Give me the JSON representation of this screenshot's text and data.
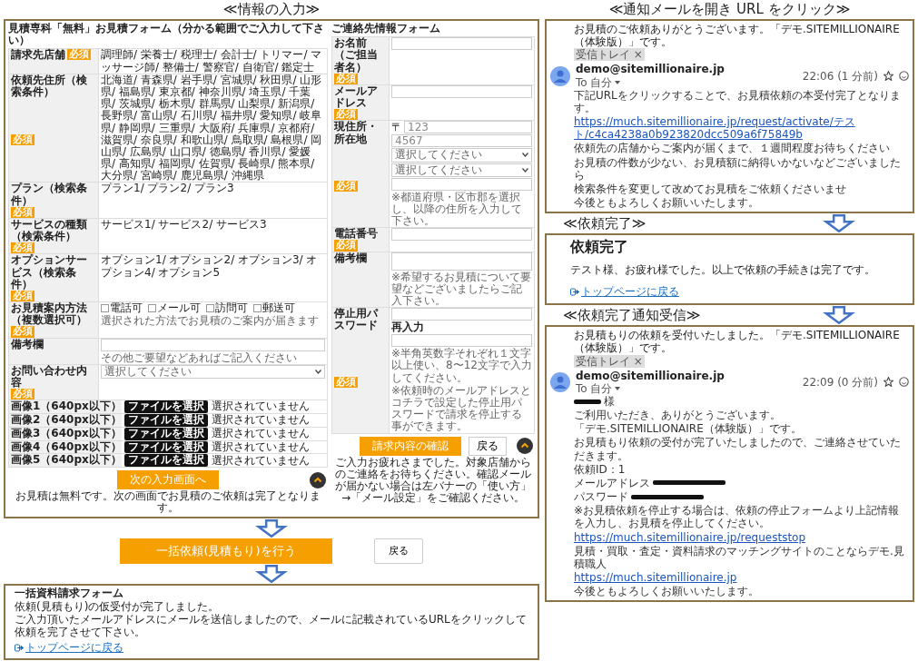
{
  "input_step": {
    "heading": "≪情報の入力≫",
    "estimate_form": {
      "title": "見積専科「無料」お見積フォーム（分かる範囲でご入力して下さい）",
      "rows": [
        {
          "kind": "text",
          "label": "請求先店舗",
          "badge": "必須",
          "value": "調理師/ 栄養士/ 税理士/ 会計士/ トリマー/ マッサージ師/ 整備士/ 警察官/ 自衛官/ 鑑定士"
        },
        {
          "kind": "text",
          "label": "依頼先住所（検索条件）",
          "badge": "必須",
          "value": "北海道/ 青森県/ 岩手県/ 宮城県/ 秋田県/ 山形県/ 福島県/ 東京都/ 神奈川県/ 埼玉県/ 千葉県/ 茨城県/ 栃木県/ 群馬県/ 山梨県/ 新潟県/ 長野県/ 富山県/ 石川県/ 福井県/ 愛知県/ 岐阜県/ 静岡県/ 三重県/ 大阪府/ 兵庫県/ 京都府/ 滋賀県/ 奈良県/ 和歌山県/ 鳥取県/ 島根県/ 岡山県/ 広島県/ 山口県/ 徳島県/ 香川県/ 愛媛県/ 高知県/ 福岡県/ 佐賀県/ 長崎県/ 熊本県/ 大分県/ 宮崎県/ 鹿児島県/ 沖縄県"
        },
        {
          "kind": "text",
          "label": "プラン（検索条件）",
          "badge": "必須",
          "value": "プラン1/ プラン2/ プラン3"
        },
        {
          "kind": "text",
          "label": "サービスの種類（検索条件）",
          "badge": "必須",
          "value": "サービス1/ サービス2/ サービス3"
        },
        {
          "kind": "text",
          "label": "オプションサービス（検索条件）",
          "badge": "必須",
          "value": "オプション1/ オプション2/ オプション3/ オプション4/ オプション5"
        },
        {
          "kind": "checkboxes",
          "label": "お見積案内方法（複数選択可）",
          "badge": "必須",
          "options": [
            {
              "label": "電話可",
              "checked": false
            },
            {
              "label": "メール可",
              "checked": false
            },
            {
              "label": "訪問可",
              "checked": false
            },
            {
              "label": "郵送可",
              "checked": false
            }
          ],
          "note": "選択された方法でお見積のご案内が届きます"
        },
        {
          "kind": "input",
          "label": "備考欄",
          "note": "その他ご要望などあればご記入ください"
        },
        {
          "kind": "select",
          "label": "お問い合わせ内容",
          "badge": "必須",
          "placeholder": "選択してください"
        },
        {
          "kind": "file",
          "label": "画像1（640px以下）",
          "button": "ファイルを選択",
          "status": "選択されていません"
        },
        {
          "kind": "file",
          "label": "画像2（640px以下）",
          "button": "ファイルを選択",
          "status": "選択されていません"
        },
        {
          "kind": "file",
          "label": "画像3（640px以下）",
          "button": "ファイルを選択",
          "status": "選択されていません"
        },
        {
          "kind": "file",
          "label": "画像4（640px以下）",
          "button": "ファイルを選択",
          "status": "選択されていません"
        },
        {
          "kind": "file",
          "label": "画像5（640px以下）",
          "button": "ファイルを選択",
          "status": "選択されていません"
        }
      ],
      "next_button": "次の入力画面へ",
      "note": "お見積は無料です。次の画面でお見積のご依頼は完了となります。"
    },
    "contact_form": {
      "title": "ご連絡先情報フォーム",
      "rows": [
        {
          "kind": "input",
          "label": "お名前（ご担当者名）",
          "badge": "必須"
        },
        {
          "kind": "input",
          "label": "メールアドレス",
          "badge": "必須"
        },
        {
          "kind": "address",
          "label": "現住所・所在地",
          "badge": "必須",
          "postal_mark": "〒",
          "postal": [
            {
              "placeholder": "123"
            },
            {
              "placeholder": "4567"
            }
          ],
          "selects": [
            "選択してください",
            "選択してください"
          ],
          "note": "※都道府県・区市郡を選択し、以降の住所を入力して下さい。"
        },
        {
          "kind": "input",
          "label": "電話番号",
          "badge": "必須"
        },
        {
          "kind": "textarea",
          "label": "備考欄",
          "note": "※希望するお見積について要望などございましたらご記入下さい。"
        },
        {
          "kind": "password",
          "label": "停止用パスワード",
          "badge": "必須",
          "reenter_label": "再入力",
          "notes": [
            "※半角英数字それぞれ１文字以上使い、8〜12文字で入力してください。",
            "※依頼時のメールアドレスとコチラで設定した停止用パスワードで請求を停止する事ができます。"
          ]
        }
      ],
      "confirm_button": "請求内容の確認",
      "back_button": "戻る",
      "note": "ご入力お疲れさまでした。対象店舗からのご連絡をお待ちください。確認メールが届かない場合は左バナーの「使い方」→「メール設定」をご確認ください。"
    }
  },
  "submit": {
    "primary_button": "一括依頼(見積もり)を行う",
    "back_button": "戻る"
  },
  "provisional": {
    "title": "一括資料請求フォーム",
    "lines": [
      "依頼(見積もり)の仮受付が完了しました。",
      "ご入力頂いたメールアドレスにメールを送信しましたので、メールに記載されているURLをクリックして依頼を完了させて下さい。"
    ],
    "link": "トップページに戻る"
  },
  "email_step": {
    "heading": "≪通知メールを開き URL をクリック≫",
    "email": {
      "subject": "お見積のご依頼ありがとうございます。「デモ.SITEMILLIONAIRE（体験版）」です。",
      "label": "受信トレイ",
      "label_close": "×",
      "sender": "demo@sitemillionaire.jp",
      "to": "To 自分",
      "time": "22:06 (1 分前)",
      "body": [
        {
          "kind": "text",
          "text": "下記URLをクリックすることで、お見積依頼の本受付完了となります。"
        },
        {
          "kind": "link",
          "text": "https://much.sitemillionaire.jp/request/activate/テスト/c4ca4238a0b923820dcc509a6f75849b"
        },
        {
          "kind": "text",
          "text": "依頼先の店舗からご案内が届くまで、１週間程度お待ちください"
        },
        {
          "kind": "text",
          "text": "お見積の件数が少ない、お見積額に納得いかないなどございましたら"
        },
        {
          "kind": "text",
          "text": "検索条件を変更して改めてお見積をご依頼くださいませ"
        },
        {
          "kind": "text",
          "text": "今後ともよろしくお願いいたします。"
        }
      ]
    }
  },
  "complete_step": {
    "heading": "≪依頼完了≫",
    "title": "依頼完了",
    "message": "テスト様、お疲れ様でした。以上で依頼の手続きは完了です。",
    "link": "トップページに戻る"
  },
  "notify_step": {
    "heading": "≪依頼完了通知受信≫",
    "email": {
      "subject": "お見積もりの依頼を受付いたしました。「デモ.SITEMILLIONAIRE（体験版）」です。",
      "label": "受信トレイ",
      "label_close": "×",
      "sender": "demo@sitemillionaire.jp",
      "to": "To 自分",
      "time": "22:09 (0 分前)",
      "body": [
        {
          "kind": "redacted_prefix",
          "text": "様"
        },
        {
          "kind": "text",
          "text": "ご利用いただき、ありがとうございます。"
        },
        {
          "kind": "text",
          "text": "「デモ.SITEMILLIONAIRE（体験版）」です。"
        },
        {
          "kind": "text",
          "text": "お見積もり依頼の受付が完了いたしましたので、ご連絡させていただきます。"
        },
        {
          "kind": "text",
          "text": "依頼ID：1"
        },
        {
          "kind": "redacted_suffix",
          "text": "メールアドレス"
        },
        {
          "kind": "redacted_suffix",
          "text": "パスワード"
        },
        {
          "kind": "text",
          "text": "※お見積依頼を停止する場合は、依頼の停止フォームより上記情報を入力し、お見積を停止してください。"
        },
        {
          "kind": "link",
          "text": "https://much.sitemillionaire.jp/requeststop"
        },
        {
          "kind": "text",
          "text": "見積・買取・査定・資料請求のマッチングサイトのことならデモ.見積職人"
        },
        {
          "kind": "link",
          "text": "https://much.sitemillionaire.jp"
        },
        {
          "kind": "text",
          "text": "今後ともよろしくお願いいたします。"
        }
      ]
    }
  }
}
